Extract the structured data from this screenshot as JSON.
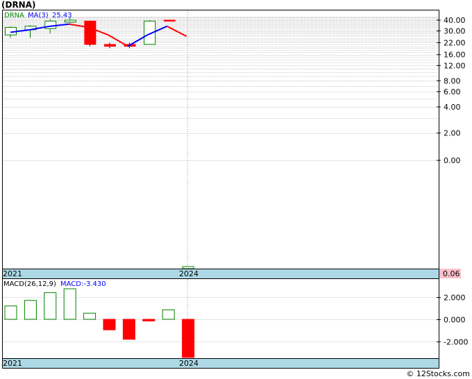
{
  "title": "(DRNA)",
  "footer": "© 12Stocks.com",
  "colors": {
    "up": "#008000",
    "down": "#ff0000",
    "ma_up": "#0000ff",
    "ma_down": "#ff0000",
    "year_bar": "#add8e6",
    "value_box": "#ffc0cb",
    "grid": "#cccccc"
  },
  "chart_data": [
    {
      "type": "candlestick",
      "name": "price",
      "legend": {
        "symbol": "DRNA",
        "ma_label": "MA(3)",
        "ma_value": "25.43"
      },
      "ylabels": [
        "40.00",
        "30.00",
        "22.00",
        "16.00",
        "12.00",
        "8.00",
        "6.00",
        "4.00",
        "2.00",
        "0.00"
      ],
      "yscale": "log",
      "xlabels": [
        "2021",
        "2024"
      ],
      "last_value_label": "0.06",
      "candles": [
        {
          "open": 27,
          "close": 33,
          "high": 34,
          "low": 25
        },
        {
          "open": 31,
          "close": 34,
          "high": 35,
          "low": 25
        },
        {
          "open": 32,
          "close": 39,
          "high": 41,
          "low": 28
        },
        {
          "open": 38,
          "close": 40,
          "high": 43,
          "low": 37
        },
        {
          "open": 39,
          "close": 21,
          "high": 39,
          "low": 20
        },
        {
          "open": 21,
          "close": 20,
          "high": 22,
          "low": 19
        },
        {
          "open": 21,
          "close": 20,
          "high": 22,
          "low": 19
        },
        {
          "open": 21,
          "close": 39,
          "high": 40,
          "low": 21
        },
        {
          "open": 40,
          "close": 39,
          "high": 40,
          "low": 39
        }
      ],
      "ma": [
        29,
        31,
        34,
        36,
        33,
        27,
        20,
        27,
        34,
        26
      ]
    },
    {
      "type": "bar",
      "name": "macd",
      "legend": {
        "label": "MACD(26,12,9)",
        "value_label": "MACD:-3.430"
      },
      "ylabels": [
        "2.000",
        "0.000",
        "-2.000"
      ],
      "xlabels": [
        "2021",
        "2024"
      ],
      "values": [
        1.2,
        1.7,
        2.4,
        2.75,
        0.55,
        -0.95,
        -1.8,
        -0.15,
        0.85,
        -3.43
      ]
    }
  ]
}
